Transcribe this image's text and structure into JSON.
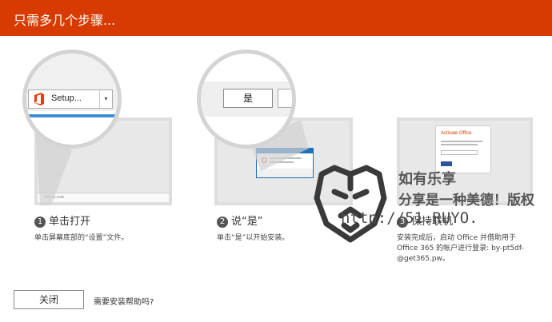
{
  "header": {
    "title": "只需多几个步骤..."
  },
  "steps": [
    {
      "number": "1",
      "title": "单击打开",
      "description": "单击屏幕底部的“设置”文件。",
      "zoom_button_label": "Setup...",
      "taskbar_text": "Setup.exe"
    },
    {
      "number": "2",
      "title": "说“是”",
      "description": "单击“是”以开始安装。",
      "zoom_button_label": "是"
    },
    {
      "number": "3",
      "title": "保持联机",
      "description_lines": [
        "安装完成后，启动 Office 并借助用于",
        "Office 365 的帐户进行登录: by-pt5df-",
        "@get365.pw。"
      ],
      "dialog_title": "Activate Office"
    }
  ],
  "footer": {
    "close_label": "关闭",
    "help_text": "需要安装帮助吗?"
  },
  "watermark": {
    "line1": "如有乐享",
    "line2": "分享是一种美德！版权",
    "url": "http://51.RUYO."
  },
  "colors": {
    "accent": "#d83b01",
    "office_icon": "#eb3c00",
    "link_blue": "#2b579a"
  }
}
